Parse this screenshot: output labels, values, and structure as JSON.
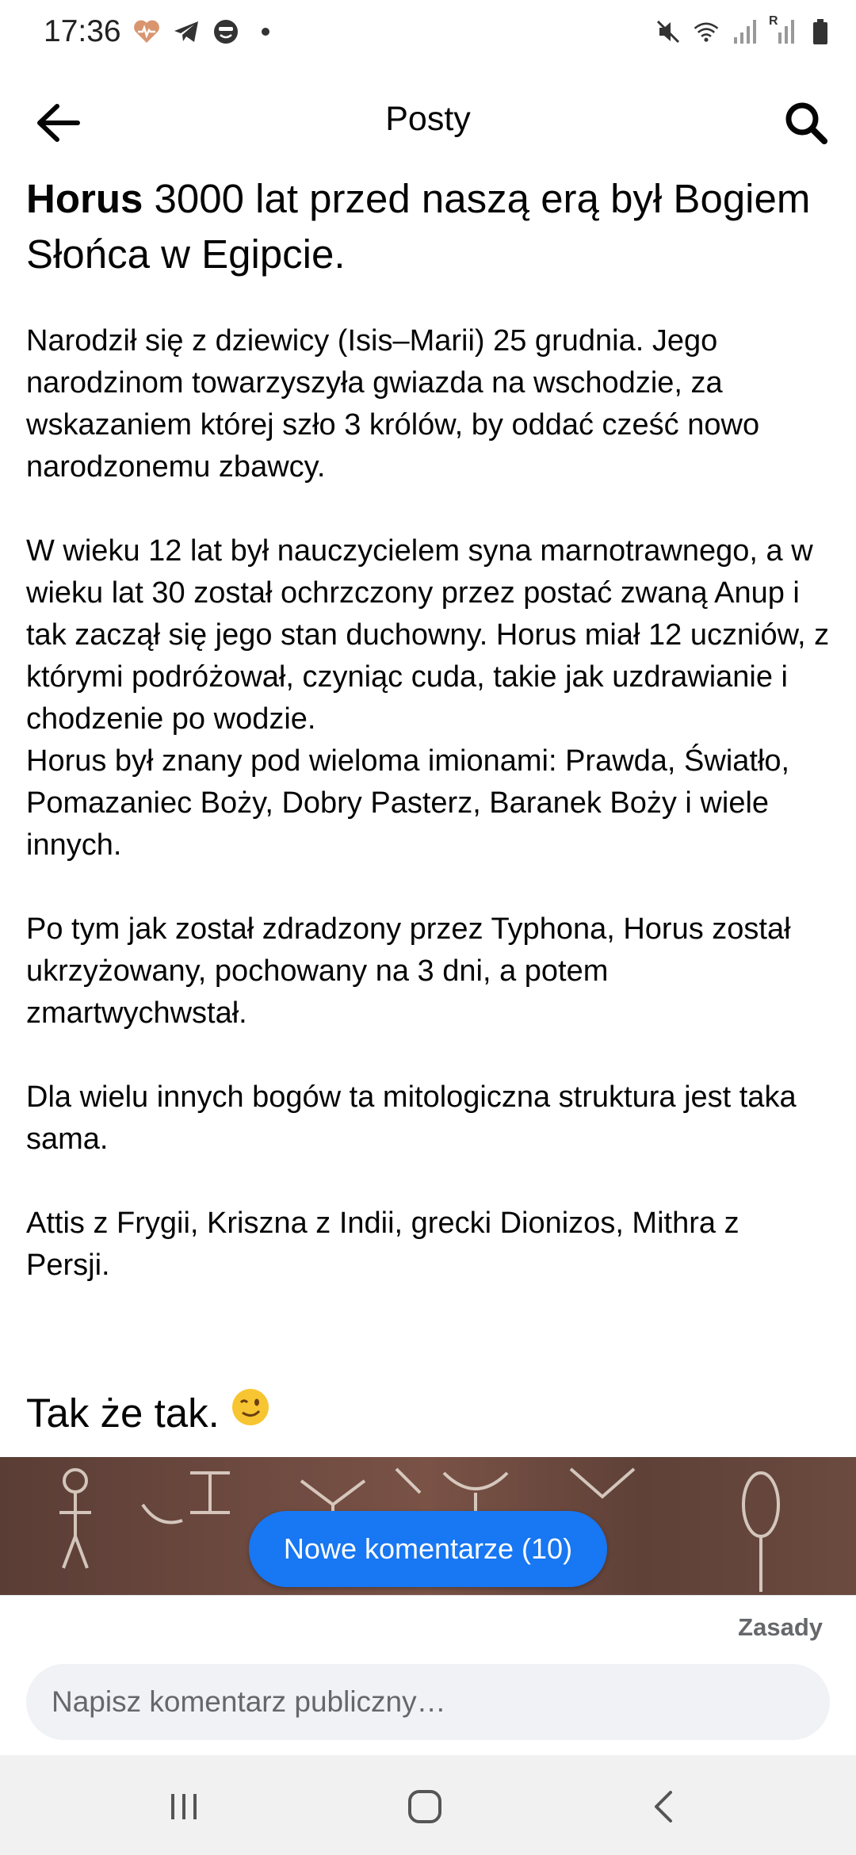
{
  "status_bar": {
    "time": "17:36",
    "left_icons": [
      "heart-pulse-icon",
      "telegram-icon",
      "face-icon",
      "dot-icon"
    ],
    "right_icons": [
      "mute-icon",
      "wifi-icon",
      "signal-icon",
      "signal-roaming-icon",
      "battery-icon"
    ],
    "roaming_label": "R"
  },
  "header": {
    "title": "Posty",
    "back_icon": "arrow-left-icon",
    "search_icon": "search-icon"
  },
  "post": {
    "heading_bold": "Horus",
    "heading_rest": " 3000 lat przed naszą erą był Bogiem Słońca w Egipcie.",
    "paragraphs": [
      "Narodził  się z dziewicy (Isis–Marii) 25 grudnia. Jego narodzinom  towarzyszyła  gwiazda na wschodzie, za wskazaniem której szło 3 królów, by  oddać  cześć nowo narodzonemu zbawcy.",
      "W wieku 12 lat był  nauczycielem  syna marnotrawnego, a w wieku lat 30 został ochrzczony przez postać  zwaną Anup i tak zaczął się jego stan duchowny. Horus miał  12 uczniów, z  którymi podróżował, czyniąc cuda, takie jak uzdrawianie i chodzenie po  wodzie.\nHorus był znany pod wieloma imionami: Prawda, Światło, Pomazaniec Boży, Dobry Pasterz, Baranek Boży i wiele innych.",
      "Po  tym jak został zdradzony przez Typhona, Horus został ukrzyżowany,  pochowany na 3 dni, a potem zmartwychwstał.",
      "Dla wielu innych bogów ta mitologiczna struktura jest taka sama.",
      "Attis z Frygii, Kriszna z Indii, grecki Dionizos, Mithra z Persji."
    ],
    "closing": "Tak że tak.",
    "closing_emoji": "😉",
    "closing_emoji_name": "winking-face-emoji"
  },
  "new_comments_button": "Nowe komentarze (10)",
  "comment_box": {
    "rules_link": "Zasady",
    "placeholder": "Napisz komentarz publiczny…"
  },
  "nav_bar": {
    "icons": [
      "recent-apps-icon",
      "home-icon",
      "back-nav-icon"
    ]
  },
  "colors": {
    "accent": "#1877f2",
    "input_bg": "#f0f2f5",
    "muted_text": "#65676b",
    "nav_bg": "#f1f1f1"
  }
}
